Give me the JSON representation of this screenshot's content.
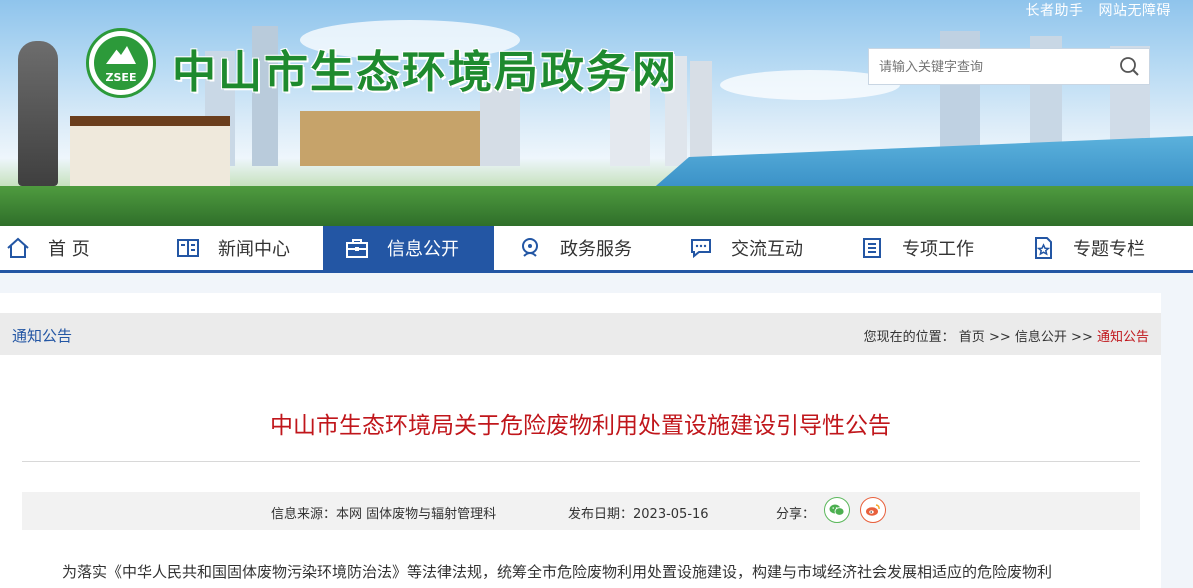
{
  "header": {
    "top_links": [
      "长者助手",
      "网站无障碍"
    ],
    "logo_text": "ZSEE",
    "site_title": "中山市生态环境局政务网",
    "search_placeholder": "请输入关键字查询"
  },
  "nav": {
    "items": [
      {
        "label": "首 页",
        "icon": "home-icon"
      },
      {
        "label": "新闻中心",
        "icon": "newspaper-icon"
      },
      {
        "label": "信息公开",
        "icon": "briefcase-icon",
        "active": true
      },
      {
        "label": "政务服务",
        "icon": "service-icon"
      },
      {
        "label": "交流互动",
        "icon": "chat-icon"
      },
      {
        "label": "专项工作",
        "icon": "document-icon"
      },
      {
        "label": "专题专栏",
        "icon": "star-icon"
      }
    ]
  },
  "breadcrumb": {
    "section": "通知公告",
    "prefix": "您现在的位置：",
    "path": [
      "首页",
      "信息公开",
      "通知公告"
    ],
    "separator": ">>"
  },
  "article": {
    "title": "中山市生态环境局关于危险废物利用处置设施建设引导性公告",
    "source": "信息来源：本网 固体废物与辐射管理科",
    "date": "发布日期：2023-05-16",
    "share_label": "分享：",
    "share_icons": [
      "wechat-icon",
      "weibo-icon"
    ],
    "body_first_line": "为落实《中华人民共和国固体废物污染环境防治法》等法律法规，统筹全市危险废物利用处置设施建设，构建与市域经济社会发展相适应的危险废物利"
  },
  "colors": {
    "nav_active": "#2356a4",
    "title_red": "#c0161b",
    "brand_green": "#1e8a2e"
  }
}
